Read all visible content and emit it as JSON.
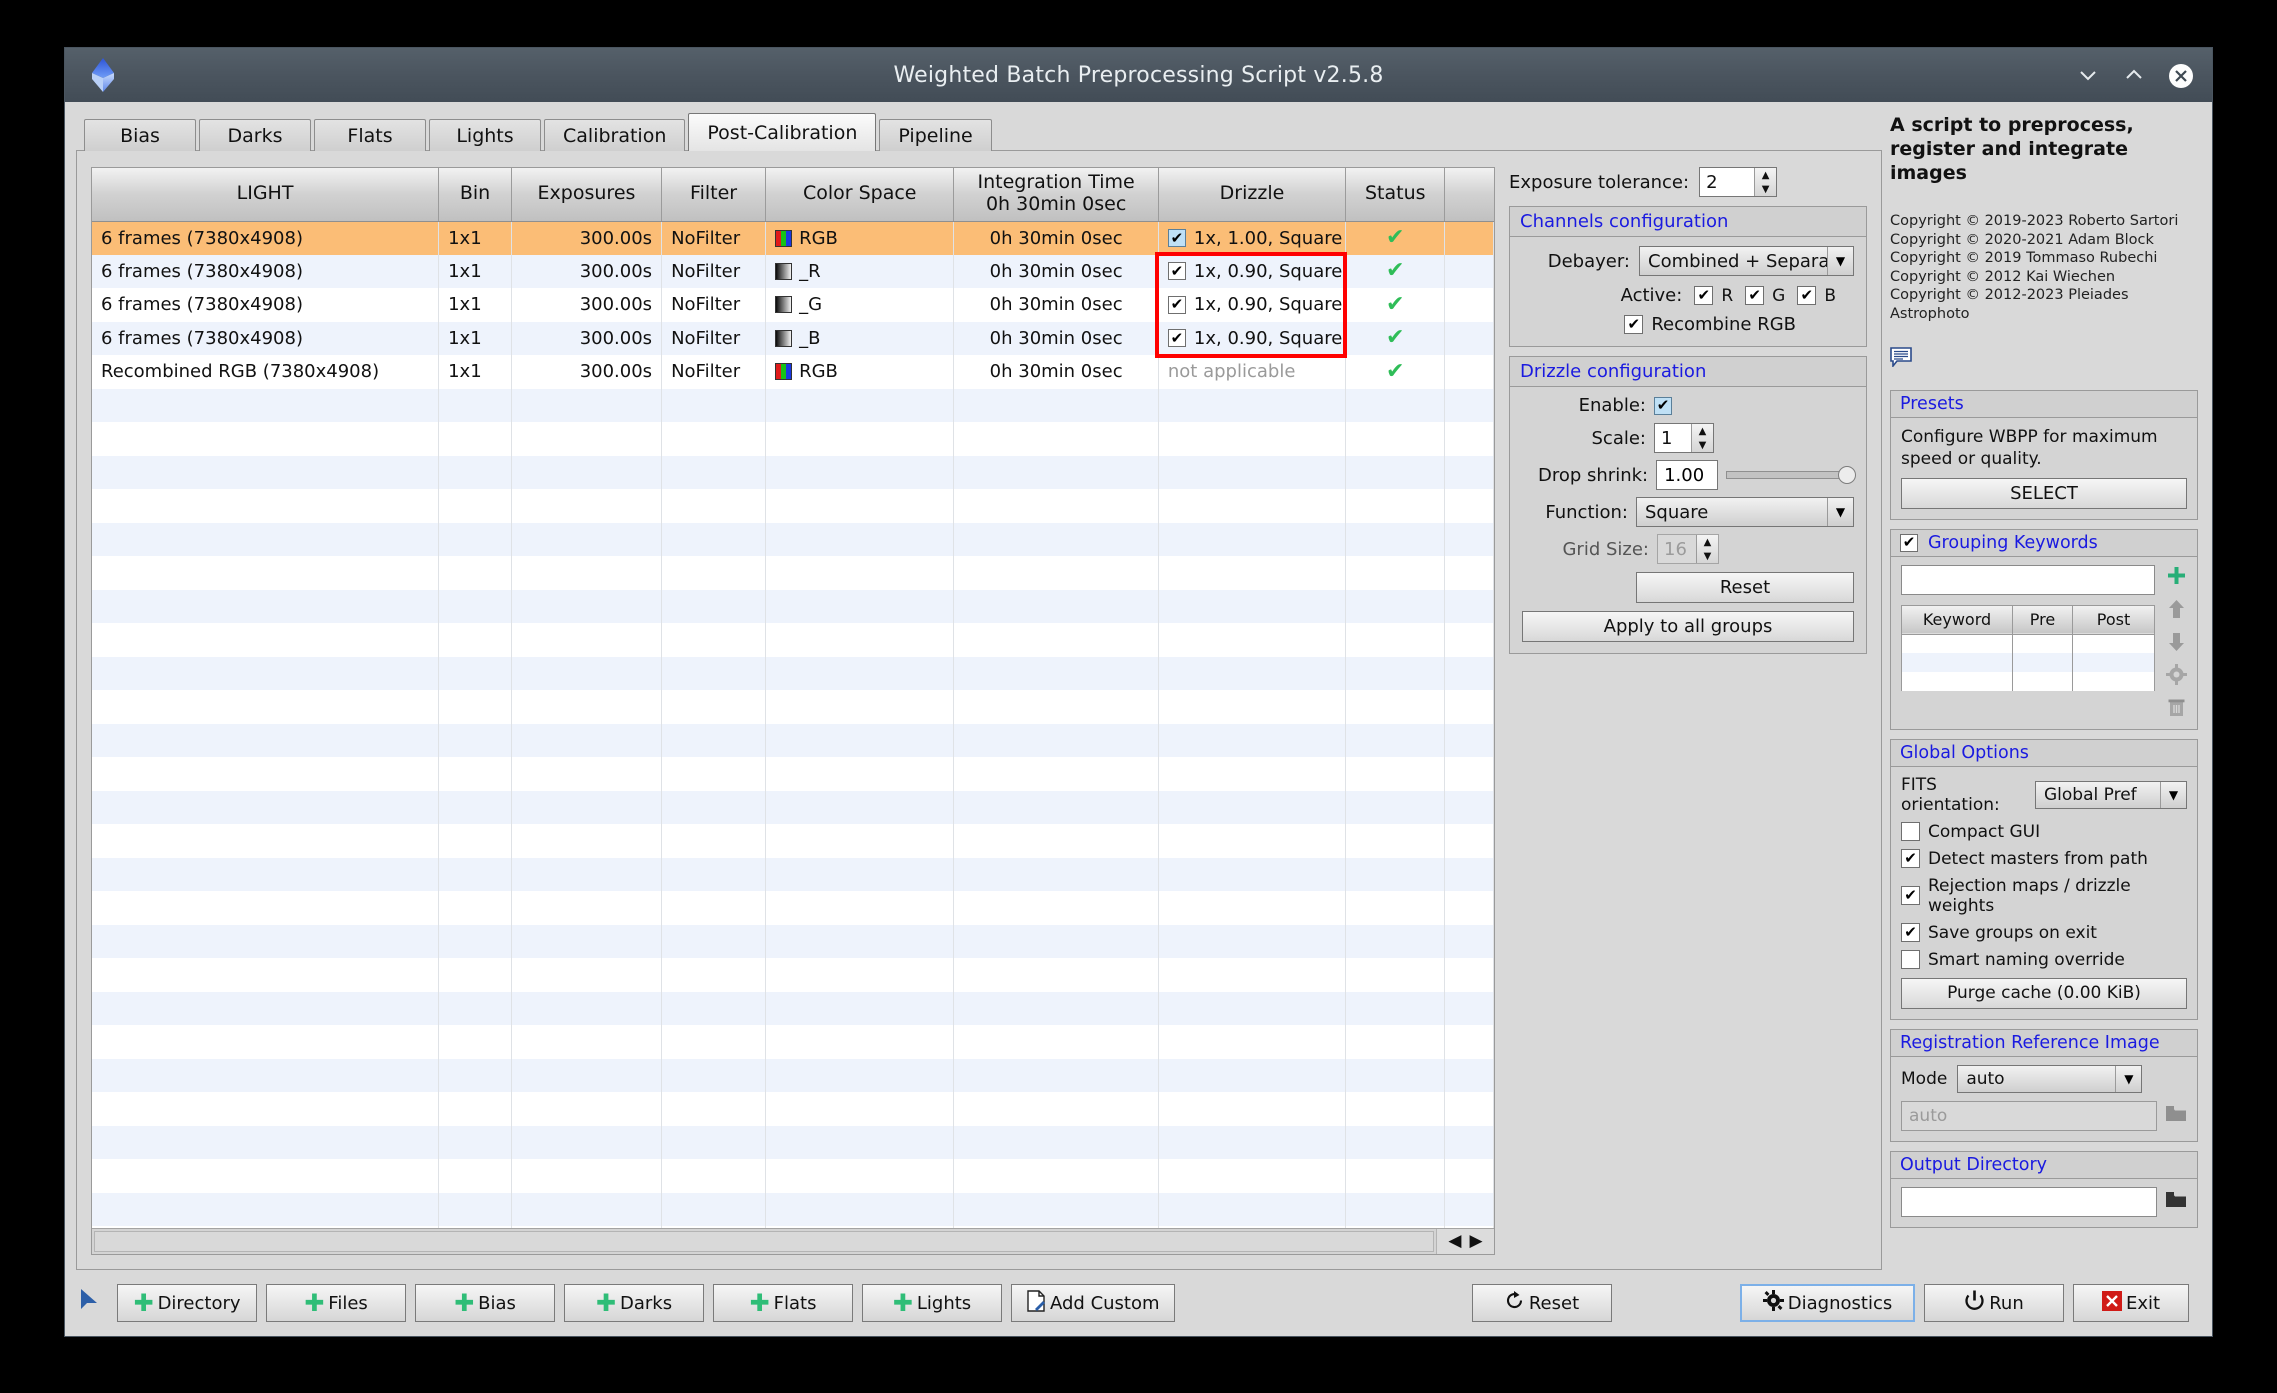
{
  "window": {
    "title": "Weighted Batch Preprocessing Script v2.5.8",
    "minimize": "⌄",
    "maximize": "⌃",
    "close": "✕"
  },
  "tabs": [
    {
      "label": "Bias",
      "active": false
    },
    {
      "label": "Darks",
      "active": false
    },
    {
      "label": "Flats",
      "active": false
    },
    {
      "label": "Lights",
      "active": false
    },
    {
      "label": "Calibration",
      "active": false
    },
    {
      "label": "Post-Calibration",
      "active": true
    },
    {
      "label": "Pipeline",
      "active": false
    }
  ],
  "table": {
    "headers": [
      "LIGHT",
      "Bin",
      "Exposures",
      "Filter",
      "Color Space",
      "Integration Time\n0h 30min  0sec",
      "Drizzle",
      "Status",
      ""
    ],
    "header_integration_line1": "Integration Time",
    "header_integration_line2": "0h 30min  0sec",
    "rows": [
      {
        "light": "6 frames (7380x4908)",
        "bin": "1x1",
        "exposures": "300.00s",
        "filter": "NoFilter",
        "colorspace": "RGB",
        "swatch": "rgb",
        "integration": "0h 30min  0sec",
        "drizzle": "1x, 1.00, Square",
        "drizzle_checked": true,
        "status": "✔",
        "selected": true
      },
      {
        "light": "6 frames (7380x4908)",
        "bin": "1x1",
        "exposures": "300.00s",
        "filter": "NoFilter",
        "colorspace": "_R",
        "swatch": "mono",
        "integration": "0h 30min  0sec",
        "drizzle": "1x, 0.90, Square",
        "drizzle_checked": true,
        "status": "✔",
        "selected": false
      },
      {
        "light": "6 frames (7380x4908)",
        "bin": "1x1",
        "exposures": "300.00s",
        "filter": "NoFilter",
        "colorspace": "_G",
        "swatch": "mono",
        "integration": "0h 30min  0sec",
        "drizzle": "1x, 0.90, Square",
        "drizzle_checked": true,
        "status": "✔",
        "selected": false
      },
      {
        "light": "6 frames (7380x4908)",
        "bin": "1x1",
        "exposures": "300.00s",
        "filter": "NoFilter",
        "colorspace": "_B",
        "swatch": "mono",
        "integration": "0h 30min  0sec",
        "drizzle": "1x, 0.90, Square",
        "drizzle_checked": true,
        "status": "✔",
        "selected": false
      },
      {
        "light": "Recombined RGB (7380x4908)",
        "bin": "1x1",
        "exposures": "300.00s",
        "filter": "NoFilter",
        "colorspace": "RGB",
        "swatch": "rgb",
        "integration": "0h 30min  0sec",
        "drizzle": "not applicable",
        "drizzle_checked": null,
        "status": "✔",
        "selected": false
      }
    ],
    "scroll_left": "◀",
    "scroll_right": "▶"
  },
  "config": {
    "exposure_tolerance_label": "Exposure tolerance:",
    "exposure_tolerance_value": "2",
    "channels": {
      "title": "Channels configuration",
      "debayer_label": "Debayer:",
      "debayer_value": "Combined + Separat",
      "active_label": "Active:",
      "active_r": "R",
      "active_g": "G",
      "active_b": "B",
      "recombine_label": "Recombine RGB"
    },
    "drizzle": {
      "title": "Drizzle configuration",
      "enable_label": "Enable:",
      "scale_label": "Scale:",
      "scale_value": "1",
      "dropshrink_label": "Drop shrink:",
      "dropshrink_value": "1.00",
      "function_label": "Function:",
      "function_value": "Square",
      "gridsize_label": "Grid Size:",
      "gridsize_value": "16",
      "reset_label": "Reset",
      "apply_all_label": "Apply to all groups"
    }
  },
  "sidebar": {
    "heading": "A script to preprocess, register and integrate images",
    "copyright": [
      "Copyright © 2019-2023 Roberto Sartori",
      "Copyright © 2020-2021 Adam Block",
      "Copyright © 2019 Tommaso Rubechi",
      "Copyright © 2012 Kai Wiechen",
      "Copyright © 2012-2023 Pleiades Astrophoto"
    ],
    "presets": {
      "title": "Presets",
      "description": "Configure WBPP for maximum speed or quality.",
      "select_label": "SELECT"
    },
    "grouping": {
      "title": "Grouping Keywords",
      "input_value": "",
      "columns": [
        "Keyword",
        "Pre",
        "Post"
      ]
    },
    "global_options": {
      "title": "Global Options",
      "fits_label": "FITS orientation:",
      "fits_value": "Global Pref",
      "items": [
        {
          "label": "Compact GUI",
          "checked": false
        },
        {
          "label": "Detect masters from path",
          "checked": true
        },
        {
          "label": "Rejection maps / drizzle weights",
          "checked": true
        },
        {
          "label": "Save groups on exit",
          "checked": true
        },
        {
          "label": "Smart naming override",
          "checked": false
        }
      ],
      "purge_label": "Purge cache (0.00 KiB)"
    },
    "registration": {
      "title": "Registration Reference Image",
      "mode_label": "Mode",
      "mode_value": "auto",
      "path_placeholder": "auto"
    },
    "output": {
      "title": "Output Directory",
      "path_value": ""
    }
  },
  "bottom": {
    "buttons": [
      {
        "label": "Directory",
        "icon": "plus"
      },
      {
        "label": "Files",
        "icon": "plus"
      },
      {
        "label": "Bias",
        "icon": "plus"
      },
      {
        "label": "Darks",
        "icon": "plus"
      },
      {
        "label": "Flats",
        "icon": "plus"
      },
      {
        "label": "Lights",
        "icon": "plus"
      },
      {
        "label": "Add Custom",
        "icon": "document-pencil"
      }
    ],
    "right_buttons": [
      {
        "label": "Reset",
        "icon": "refresh"
      },
      {
        "label": "Diagnostics",
        "icon": "gear"
      },
      {
        "label": "Run",
        "icon": "power"
      },
      {
        "label": "Exit",
        "icon": "red-x"
      }
    ]
  },
  "colors": {
    "selected_row": "#fbbd76",
    "alt_row": "#eef3fc",
    "accent_blue": "#1a1ae0",
    "green_check": "#2fbd58",
    "red_highlight": "#ff0000",
    "titlebar": "#4b555f"
  }
}
